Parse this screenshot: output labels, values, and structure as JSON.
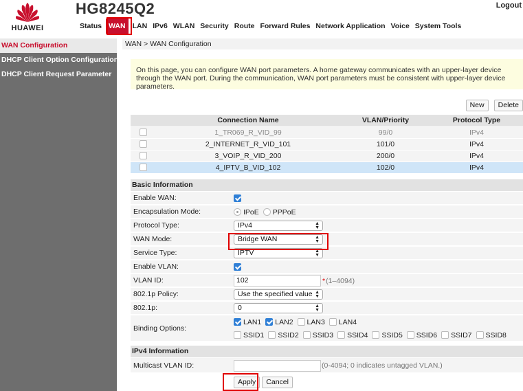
{
  "header": {
    "brand": "HUAWEI",
    "model": "HG8245Q2",
    "logout": "Logout",
    "nav": [
      "Status",
      "WAN",
      "LAN",
      "IPv6",
      "WLAN",
      "Security",
      "Route",
      "Forward Rules",
      "Network Application",
      "Voice",
      "System Tools"
    ],
    "active_nav": "WAN"
  },
  "sidebar": {
    "items": [
      "WAN Configuration",
      "DHCP Client Option Configuration",
      "DHCP Client Request Parameter"
    ],
    "active": "WAN Configuration"
  },
  "breadcrumb": "WAN > WAN Configuration",
  "notice": "On this page, you can configure WAN port parameters. A home gateway communicates with an upper-layer device through the WAN port. During the communication, WAN port parameters must be consistent with upper-layer device parameters.",
  "table": {
    "new_label": "New",
    "delete_label": "Delete",
    "headers": [
      "Connection Name",
      "VLAN/Priority",
      "Protocol Type"
    ],
    "rows": [
      {
        "name": "1_TR069_R_VID_99",
        "vlan": "99/0",
        "protocol": "IPv4"
      },
      {
        "name": "2_INTERNET_R_VID_101",
        "vlan": "101/0",
        "protocol": "IPv4"
      },
      {
        "name": "3_VOIP_R_VID_200",
        "vlan": "200/0",
        "protocol": "IPv4"
      },
      {
        "name": "4_IPTV_B_VID_102",
        "vlan": "102/0",
        "protocol": "IPv4"
      }
    ],
    "selected_row": 3
  },
  "form": {
    "basic_title": "Basic Information",
    "enable_wan_label": "Enable WAN:",
    "enable_wan": true,
    "encapsulation_label": "Encapsulation Mode:",
    "encap_ipoe": "IPoE",
    "encap_pppoe": "PPPoE",
    "encap_selected": "IPoE",
    "protocol_label": "Protocol Type:",
    "protocol_value": "IPv4",
    "wan_mode_label": "WAN Mode:",
    "wan_mode_value": "Bridge WAN",
    "service_label": "Service Type:",
    "service_value": "IPTV",
    "enable_vlan_label": "Enable VLAN:",
    "enable_vlan": true,
    "vlan_id_label": "VLAN ID:",
    "vlan_id_value": "102",
    "vlan_id_req": "*",
    "vlan_id_hint": "(1–4094)",
    "policy_label": "802.1p Policy:",
    "policy_value": "Use the specified value",
    "p_label": "802.1p:",
    "p_value": "0",
    "binding_label": "Binding Options:",
    "lan": [
      "LAN1",
      "LAN2",
      "LAN3",
      "LAN4"
    ],
    "lan_checked": [
      true,
      true,
      false,
      false
    ],
    "ssid": [
      "SSID1",
      "SSID2",
      "SSID3",
      "SSID4",
      "SSID5",
      "SSID6",
      "SSID7",
      "SSID8"
    ],
    "ipv4_title": "IPv4 Information",
    "mcast_label": "Multicast VLAN ID:",
    "mcast_value": "",
    "mcast_hint": "(0-4094; 0 indicates untagged VLAN.)",
    "apply_label": "Apply",
    "cancel_label": "Cancel"
  },
  "colors": {
    "brand_red": "#c8102e",
    "highlight": "#e00000",
    "sidebar_bg": "#6e6e6e",
    "selected_row": "#cfe5f8",
    "checkbox_blue": "#2f7fd6"
  }
}
